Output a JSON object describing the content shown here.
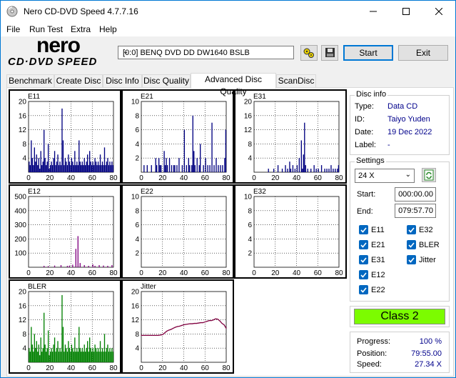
{
  "window": {
    "title": "Nero CD-DVD Speed 4.7.7.16"
  },
  "menu": {
    "file": "File",
    "run_test": "Run Test",
    "extra": "Extra",
    "help": "Help"
  },
  "logo": {
    "brand": "nero",
    "subtitle": "CD·DVD SPEED"
  },
  "toolbar": {
    "drive": "[0:0]   BENQ DVD DD DW1640 BSLB",
    "start_label": "Start",
    "exit_label": "Exit"
  },
  "tabs": [
    "Benchmark",
    "Create Disc",
    "Disc Info",
    "Disc Quality",
    "Advanced Disc Quality",
    "ScanDisc"
  ],
  "active_tab": "Advanced Disc Quality",
  "disc_info": {
    "title": "Disc info",
    "type_label": "Type:",
    "type": "Data CD",
    "id_label": "ID:",
    "id": "Taiyo Yuden",
    "date_label": "Date:",
    "date": "19 Dec 2022",
    "label_label": "Label:",
    "label": "-"
  },
  "settings": {
    "title": "Settings",
    "speed": "24 X",
    "start_label": "Start:",
    "start": "000:00.00",
    "end_label": "End:",
    "end": "079:57.70",
    "checks": {
      "e11": "E11",
      "e21": "E21",
      "e31": "E31",
      "e12": "E12",
      "e22": "E22",
      "e32": "E32",
      "bler": "BLER",
      "jitter": "Jitter"
    }
  },
  "class": "Class 2",
  "progress": {
    "progress_label": "Progress:",
    "progress": "100 %",
    "position_label": "Position:",
    "position": "79:55.00",
    "speed_label": "Speed:",
    "speed": "27.34 X"
  },
  "chart_data": [
    {
      "type": "bar",
      "name": "E11",
      "title": "E11",
      "xlim": [
        0,
        80
      ],
      "ylim": [
        0,
        20
      ],
      "yticks": [
        4,
        8,
        12,
        16,
        20
      ],
      "xticks": [
        0,
        20,
        40,
        60,
        80
      ],
      "grid": true,
      "color": "#000080",
      "x": [
        0,
        1,
        2,
        3,
        4,
        5,
        6,
        7,
        8,
        9,
        10,
        11,
        12,
        13,
        14,
        15,
        16,
        17,
        18,
        19,
        20,
        21,
        22,
        23,
        24,
        25,
        26,
        27,
        28,
        29,
        30,
        31,
        32,
        33,
        34,
        35,
        36,
        37,
        38,
        39,
        40,
        41,
        42,
        43,
        44,
        45,
        46,
        47,
        48,
        49,
        50,
        51,
        52,
        53,
        54,
        55,
        56,
        57,
        58,
        59,
        60,
        61,
        62,
        63,
        64,
        65,
        66,
        67,
        68,
        69,
        70,
        71,
        72,
        73,
        74,
        75,
        76,
        77,
        78,
        79
      ],
      "values": [
        3,
        2,
        9,
        4,
        2,
        7,
        3,
        5,
        2,
        4,
        1,
        6,
        2,
        3,
        12,
        4,
        2,
        3,
        8,
        1,
        2,
        3,
        2,
        4,
        6,
        2,
        3,
        5,
        2,
        3,
        2,
        18,
        9,
        2,
        4,
        3,
        2,
        5,
        3,
        2,
        4,
        3,
        2,
        6,
        2,
        3,
        2,
        9,
        3,
        2,
        3,
        2,
        4,
        2,
        3,
        5,
        2,
        6,
        3,
        2,
        3,
        2,
        4,
        3,
        2,
        3,
        2,
        5,
        2,
        3,
        2,
        7,
        2,
        3,
        4,
        2,
        3,
        2,
        3,
        2
      ]
    },
    {
      "type": "bar",
      "name": "E21",
      "title": "E21",
      "xlim": [
        0,
        80
      ],
      "ylim": [
        0,
        10
      ],
      "yticks": [
        2,
        4,
        6,
        8,
        10
      ],
      "xticks": [
        0,
        20,
        40,
        60,
        80
      ],
      "grid": true,
      "color": "#000080",
      "x": [
        2,
        5,
        9,
        13,
        14,
        16,
        17,
        18,
        21,
        22,
        23,
        24,
        26,
        28,
        30,
        31,
        33,
        35,
        38,
        40,
        42,
        44,
        45,
        47,
        48,
        49,
        50,
        52,
        54,
        55,
        58,
        60,
        62,
        64,
        66,
        68,
        70,
        72,
        74,
        76,
        78,
        79
      ],
      "values": [
        1,
        1,
        1,
        2,
        1,
        2,
        1,
        1,
        3,
        1,
        2,
        1,
        2,
        1,
        1,
        1,
        1,
        2,
        1,
        6,
        1,
        2,
        1,
        1,
        8,
        3,
        1,
        2,
        1,
        4,
        1,
        2,
        1,
        1,
        7,
        1,
        2,
        1,
        1,
        1,
        2,
        6
      ]
    },
    {
      "type": "bar",
      "name": "E31",
      "title": "E31",
      "xlim": [
        0,
        80
      ],
      "ylim": [
        0,
        20
      ],
      "yticks": [
        4,
        8,
        12,
        16,
        20
      ],
      "xticks": [
        0,
        20,
        40,
        60,
        80
      ],
      "grid": true,
      "color": "#000080",
      "x": [
        13,
        18,
        22,
        26,
        29,
        31,
        33,
        34,
        36,
        38,
        40,
        42,
        44,
        45,
        46,
        47,
        48,
        50,
        53,
        56,
        58,
        60,
        63,
        66,
        68,
        70,
        72,
        74,
        76,
        78,
        79
      ],
      "values": [
        1,
        1,
        2,
        1,
        2,
        1,
        3,
        1,
        2,
        1,
        2,
        4,
        9,
        1,
        5,
        14,
        2,
        1,
        1,
        2,
        1,
        1,
        2,
        1,
        1,
        1,
        2,
        1,
        1,
        1,
        2
      ]
    },
    {
      "type": "bar",
      "name": "E12",
      "title": "E12",
      "xlim": [
        0,
        80
      ],
      "ylim": [
        0,
        500
      ],
      "yticks": [
        100,
        200,
        300,
        400,
        500
      ],
      "xticks": [
        0,
        20,
        40,
        60,
        80
      ],
      "grid": true,
      "color": "#800080",
      "x": [
        14,
        18,
        24,
        30,
        36,
        38,
        41,
        44,
        46,
        48,
        52,
        56,
        60,
        62,
        66,
        70,
        74,
        78
      ],
      "values": [
        10,
        8,
        12,
        15,
        10,
        12,
        18,
        130,
        220,
        30,
        15,
        10,
        20,
        10,
        15,
        12,
        10,
        15
      ]
    },
    {
      "type": "bar",
      "name": "E22",
      "title": "E22",
      "xlim": [
        0,
        80
      ],
      "ylim": [
        0,
        10
      ],
      "yticks": [
        2,
        4,
        6,
        8,
        10
      ],
      "xticks": [
        0,
        20,
        40,
        60,
        80
      ],
      "grid": true,
      "color": "#000080",
      "x": [],
      "values": []
    },
    {
      "type": "bar",
      "name": "E32",
      "title": "E32",
      "xlim": [
        0,
        80
      ],
      "ylim": [
        0,
        10
      ],
      "yticks": [
        2,
        4,
        6,
        8,
        10
      ],
      "xticks": [
        0,
        20,
        40,
        60,
        80
      ],
      "grid": true,
      "color": "#000080",
      "x": [],
      "values": []
    },
    {
      "type": "bar",
      "name": "BLER",
      "title": "BLER",
      "xlim": [
        0,
        80
      ],
      "ylim": [
        0,
        20
      ],
      "yticks": [
        4,
        8,
        12,
        16,
        20
      ],
      "xticks": [
        0,
        20,
        40,
        60,
        80
      ],
      "grid": true,
      "color": "#008000",
      "x": [
        0,
        1,
        2,
        3,
        4,
        5,
        6,
        7,
        8,
        9,
        10,
        11,
        12,
        13,
        14,
        15,
        16,
        17,
        18,
        19,
        20,
        21,
        22,
        23,
        24,
        25,
        26,
        27,
        28,
        29,
        30,
        31,
        32,
        33,
        34,
        35,
        36,
        37,
        38,
        39,
        40,
        41,
        42,
        43,
        44,
        45,
        46,
        47,
        48,
        49,
        50,
        51,
        52,
        53,
        54,
        55,
        56,
        57,
        58,
        59,
        60,
        61,
        62,
        63,
        64,
        65,
        66,
        67,
        68,
        69,
        70,
        71,
        72,
        73,
        74,
        75,
        76,
        77,
        78,
        79
      ],
      "values": [
        4,
        3,
        10,
        5,
        3,
        8,
        4,
        6,
        3,
        5,
        2,
        7,
        3,
        4,
        14,
        5,
        3,
        4,
        9,
        2,
        3,
        4,
        3,
        5,
        7,
        3,
        4,
        6,
        3,
        4,
        3,
        19,
        10,
        3,
        5,
        4,
        3,
        6,
        4,
        3,
        5,
        4,
        3,
        7,
        3,
        4,
        3,
        10,
        4,
        3,
        4,
        3,
        5,
        3,
        4,
        6,
        3,
        7,
        4,
        3,
        4,
        3,
        5,
        4,
        3,
        4,
        3,
        6,
        3,
        4,
        3,
        8,
        3,
        4,
        5,
        3,
        4,
        3,
        4,
        3
      ]
    },
    {
      "type": "line",
      "name": "Jitter",
      "title": "Jitter",
      "xlim": [
        0,
        80
      ],
      "ylim": [
        0,
        20
      ],
      "yticks": [
        4,
        8,
        12,
        16,
        20
      ],
      "xticks": [
        0,
        20,
        40,
        60,
        80
      ],
      "grid": true,
      "color": "#800040",
      "x": [
        0,
        2,
        4,
        6,
        8,
        10,
        12,
        14,
        16,
        18,
        20,
        22,
        24,
        26,
        28,
        30,
        32,
        34,
        36,
        38,
        40,
        42,
        44,
        46,
        48,
        50,
        52,
        54,
        56,
        58,
        60,
        62,
        64,
        66,
        68,
        70,
        72,
        74,
        76,
        78,
        80
      ],
      "values": [
        7.6,
        7.6,
        7.6,
        7.6,
        7.6,
        7.6,
        7.6,
        7.6,
        7.6,
        7.7,
        7.8,
        8.3,
        8.8,
        9.1,
        9.3,
        9.6,
        9.9,
        10.1,
        10.2,
        10.4,
        10.6,
        10.7,
        10.8,
        10.9,
        10.9,
        11.0,
        11.0,
        11.1,
        11.2,
        11.2,
        11.4,
        11.6,
        11.8,
        11.8,
        12.0,
        12.3,
        12.2,
        11.7,
        11.0,
        10.6,
        9.6
      ]
    }
  ]
}
